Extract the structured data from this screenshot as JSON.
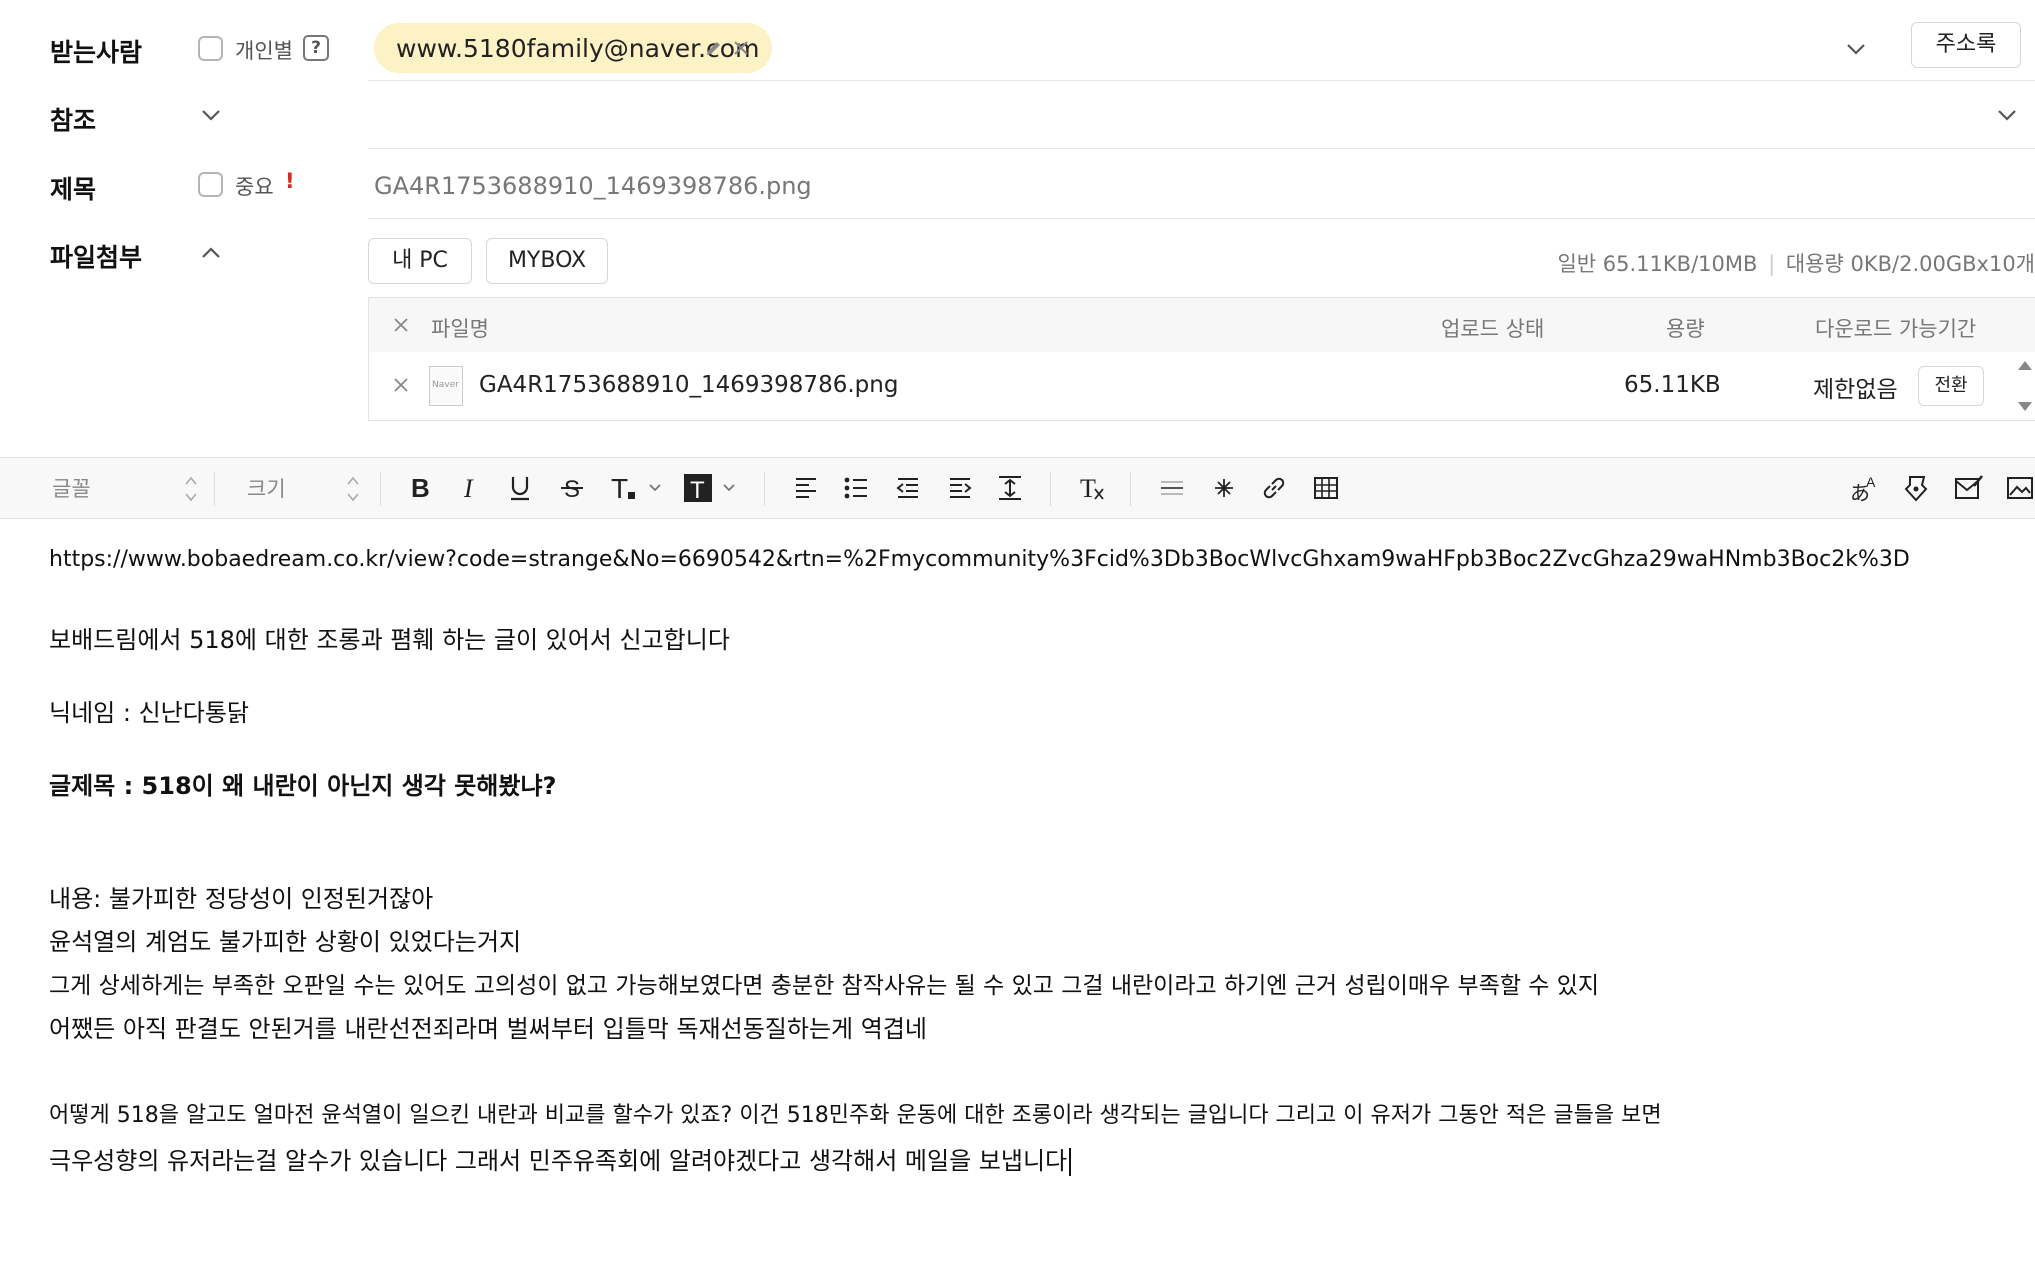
{
  "recipient": {
    "label": "받는사람",
    "individual_label": "개인별",
    "help": "?",
    "chip_email": "www.5180family@naver.com",
    "address_book": "주소록"
  },
  "cc": {
    "label": "참조"
  },
  "subject": {
    "label": "제목",
    "important_label": "중요",
    "important_mark": "!",
    "value": "GA4R1753688910_1469398786.png"
  },
  "attachment": {
    "label": "파일첨부",
    "my_pc": "내 PC",
    "mybox": "MYBOX",
    "quota_normal": "일반 65.11KB/10MB",
    "quota_separator": "|",
    "quota_large": "대용량 0KB/2.00GBx10개",
    "columns": {
      "name": "파일명",
      "status": "업로드 상태",
      "size": "용량",
      "period": "다운로드 가능기간"
    },
    "file": {
      "name": "GA4R1753688910_1469398786.png",
      "thumb_text": "Naver",
      "size": "65.11KB",
      "period": "제한없음",
      "convert": "전환"
    }
  },
  "toolbar": {
    "font": "글꼴",
    "size": "크기"
  },
  "body": {
    "url": "https://www.bobaedream.co.kr/view?code=strange&No=6690542&rtn=%2Fmycommunity%3Fcid%3Db3BocWlvcGhxam9waHFpb3Boc2ZvcGhza29waHNmb3Boc2k%3D",
    "line1": "보배드림에서 518에 대한 조롱과 폄훼 하는 글이 있어서 신고합니다",
    "line2": "닉네임 : 신난다통닭",
    "line3": "글제목 : 518이 왜 내란이 아닌지 생각 못해봤냐?",
    "line4": "내용: 불가피한 정당성이 인정된거잖아",
    "line5": "윤석열의 계엄도 불가피한 상황이 있었다는거지",
    "line6": "그게 상세하게는 부족한 오판일 수는 있어도 고의성이 없고 가능해보였다면 충분한 참작사유는 될 수 있고 그걸 내란이라고 하기엔 근거 성립이매우 부족할 수 있지",
    "line7": "어쨌든 아직 판결도 안된거를 내란선전죄라며 벌써부터 입틀막 독재선동질하는게 역겹네",
    "line8": "어떻게 518을 알고도 얼마전 윤석열이 일으킨 내란과 비교를 할수가 있죠? 이건 518민주화 운동에 대한 조롱이라 생각되는 글입니다 그리고 이 유저가 그동안 적은 글들을 보면",
    "line9": "극우성향의 유저라는걸 알수가 있습니다 그래서 민주유족회에 알려야겠다고 생각해서 메일을 보냅니다"
  },
  "colors": {
    "chip_bg": "#fdf1c6",
    "important": "#e0261c",
    "border": "#e3e3e3"
  }
}
